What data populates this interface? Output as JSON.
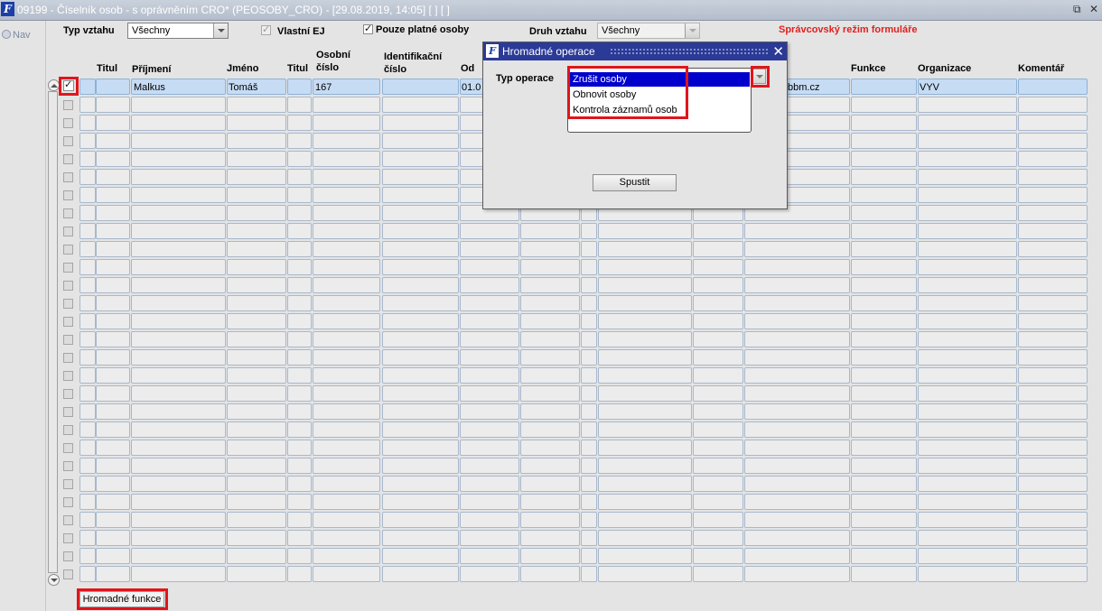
{
  "window": {
    "title": "09199 - Číselník osob - s oprávněním CRO* (PEOSOBY_CRO) - [29.08.2019, 14:05]  [ ]  [ ]",
    "buttons": [
      "⧉",
      "✕"
    ]
  },
  "nav": {
    "label": "Nav"
  },
  "filters": {
    "typ_vztahu_label": "Typ vztahu",
    "typ_vztahu_value": "Všechny",
    "vlastni_ej_label": "Vlastní EJ",
    "vlastni_ej_checked": true,
    "pouze_platne_label": "Pouze platné osoby",
    "pouze_platne_checked": true,
    "druh_vztahu_label": "Druh vztahu",
    "druh_vztahu_value": "Všechny",
    "admin_mode": "Správcovský režim formuláře"
  },
  "table": {
    "headers": {
      "titul1": "Titul",
      "prijmeni": "Příjmení",
      "jmeno": "Jméno",
      "titul2": "Titul",
      "osobni_cislo": "Osobní\nčíslo",
      "identifikacni_cislo": "Identifikační\nčíslo",
      "od": "Od",
      "funkce": "Funkce",
      "organizace": "Organizace",
      "komentar": "Komentář"
    },
    "first_row": {
      "prijmeni": "Malkus",
      "jmeno": "Tomáš",
      "osobni_cislo": "167",
      "od": "01.0",
      "email_fragment": "bbm.cz",
      "organizace": "VYV"
    }
  },
  "footer": {
    "hromadne_funkce": "Hromadné funkce"
  },
  "dialog": {
    "title": "Hromadné operace",
    "close": "✕",
    "typ_operace_label": "Typ operace",
    "options": [
      "Zrušit osoby",
      "Obnovit osoby",
      "Kontrola záznamů osob"
    ],
    "selected_index": 0,
    "run_button": "Spustit"
  },
  "colors": {
    "highlight": "#e0151b",
    "selected_row": "#c6dcf4",
    "dialog_title": "#2b3a97"
  }
}
